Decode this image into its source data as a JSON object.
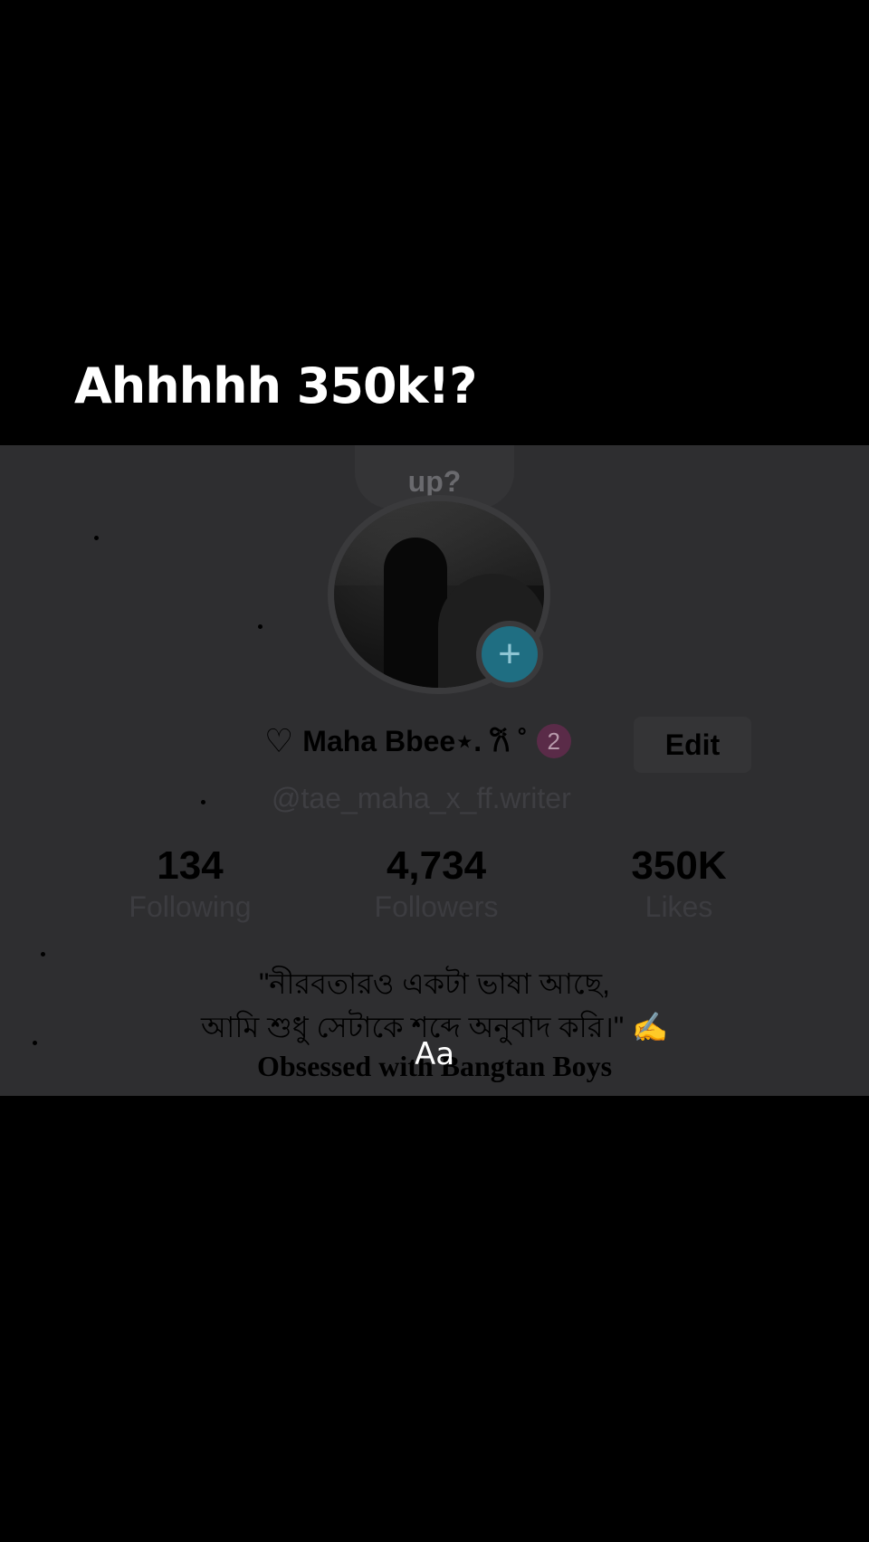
{
  "caption": "Ahhhhh 350k!?",
  "profile": {
    "bubble_text": "up?",
    "display_name": "Maha Bbee⋆. 𐙚 ˚",
    "badge_count": "2",
    "edit_label": "Edit",
    "username": "@tae_maha_x_ff.writer",
    "stats": [
      {
        "value": "134",
        "label": "Following"
      },
      {
        "value": "4,734",
        "label": "Followers"
      },
      {
        "value": "350K",
        "label": "Likes"
      }
    ],
    "bio_line1": "\"নীরবতারও একটা ভাষা আছে,",
    "bio_line2": "আমি শুধু সেটাকে শব্দে অনুবাদ করি।\" ✍️",
    "bio_line3": "Obsessed with Bangtan Boys"
  },
  "text_tool_label": "Aa",
  "colors": {
    "background": "#000000",
    "panel": "#2e2e30",
    "caption": "#ffffff"
  }
}
